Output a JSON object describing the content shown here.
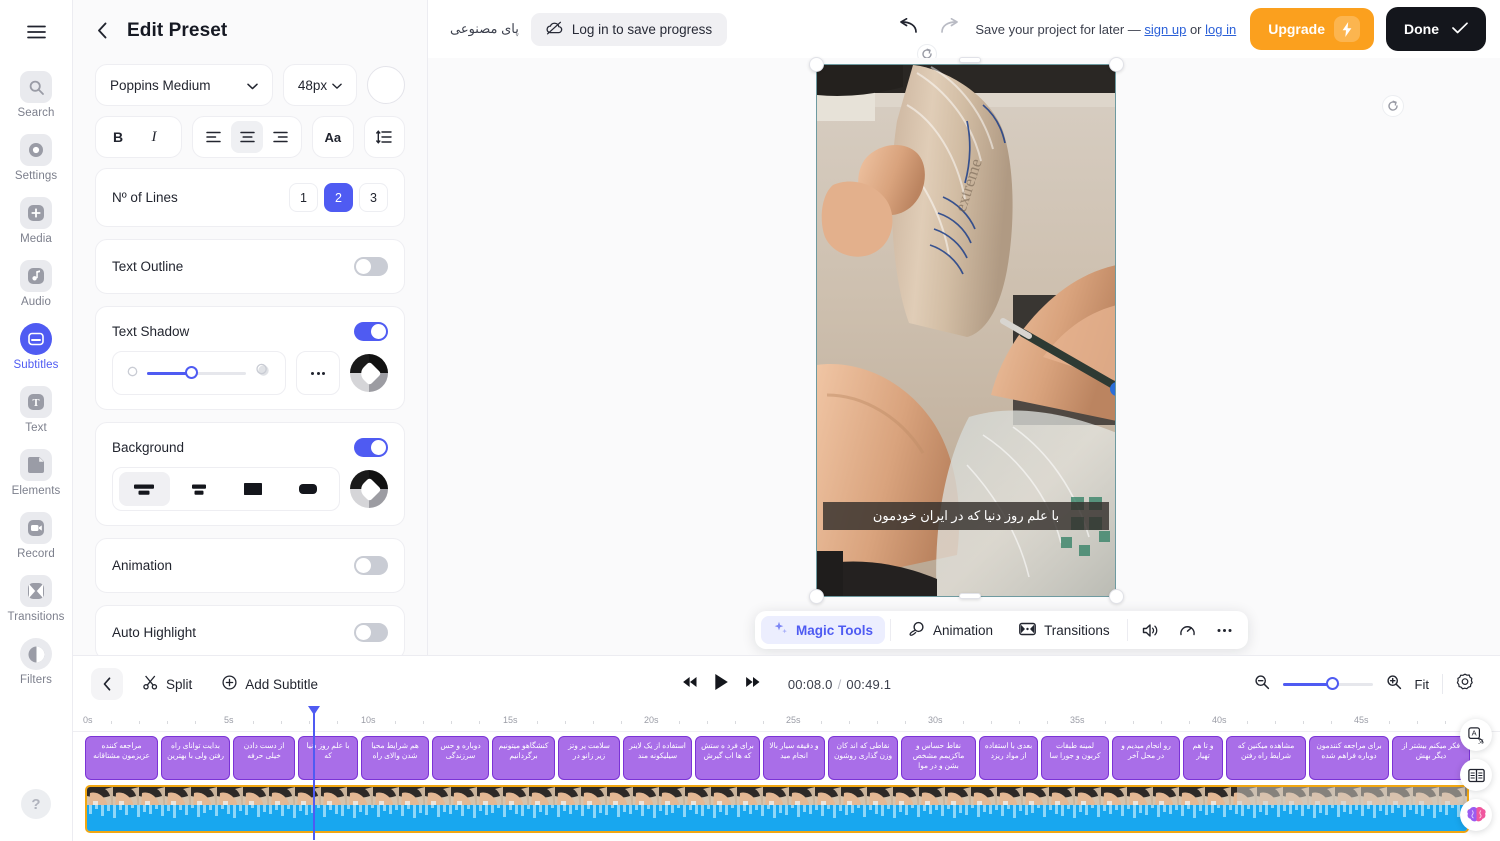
{
  "rail": {
    "menu_icon": "hamburger-icon",
    "items": [
      {
        "label": "Search",
        "icon": "search-icon",
        "active": false
      },
      {
        "label": "Settings",
        "icon": "gear-icon",
        "active": false
      },
      {
        "label": "Media",
        "icon": "plus-square-icon",
        "active": false
      },
      {
        "label": "Audio",
        "icon": "music-note-icon",
        "active": false
      },
      {
        "label": "Subtitles",
        "icon": "subtitles-icon",
        "active": true
      },
      {
        "label": "Text",
        "icon": "text-t-icon",
        "active": false
      },
      {
        "label": "Elements",
        "icon": "sticker-icon",
        "active": false
      },
      {
        "label": "Record",
        "icon": "record-camera-icon",
        "active": false
      },
      {
        "label": "Transitions",
        "icon": "transitions-icon",
        "active": false
      },
      {
        "label": "Filters",
        "icon": "filters-contrast-icon",
        "active": false
      }
    ],
    "help_label": "?"
  },
  "panel": {
    "title": "Edit Preset",
    "back_icon": "chevron-left-icon",
    "font_family": "Poppins Medium",
    "font_size": "48px",
    "color_swatch": "#ffffff",
    "bold_label": "B",
    "italic_label": "I",
    "align_options": [
      "align-left",
      "align-center",
      "align-right"
    ],
    "align_selected": "align-center",
    "case_label": "Aa",
    "line_height_icon": "line-height-icon",
    "lines": {
      "label": "Nº of Lines",
      "options": [
        "1",
        "2",
        "3"
      ],
      "selected": "2"
    },
    "text_outline": {
      "label": "Text Outline",
      "on": false
    },
    "text_shadow": {
      "label": "Text Shadow",
      "on": true,
      "more_icon": "more-dots-icon",
      "color_icon": "paint-bucket-icon"
    },
    "background": {
      "label": "Background",
      "on": true,
      "styles": [
        "bg-two-lines-wide",
        "bg-two-lines-narrow",
        "bg-solid-rect",
        "bg-rounded-rect"
      ],
      "selected": "bg-two-lines-wide",
      "color_icon": "paint-bucket-icon"
    },
    "animation": {
      "label": "Animation",
      "on": false
    },
    "auto_highlight": {
      "label": "Auto Highlight",
      "on": false
    }
  },
  "header": {
    "project_title": "پای مصنوعی",
    "login_pill": {
      "label": "Log in to save progress",
      "icon": "cloud-off-icon"
    },
    "undo_icon": "undo-arrow-icon",
    "redo_icon": "redo-arrow-icon",
    "reset_icon": "reset-circle-icon",
    "save_note_prefix": "Save your project for later — ",
    "save_note_signup": "sign up",
    "save_note_or": " or ",
    "save_note_login": "log in",
    "upgrade_label": "Upgrade",
    "upgrade_icon": "lightning-bolt-icon",
    "upgrade_color": "#fba01e",
    "done_label": "Done",
    "done_icon": "check-icon"
  },
  "canvas": {
    "rotate_icon": "rotate-handle-icon",
    "subtitle_text": "با علم روز دنیا که در ایران خودمون",
    "floating_toolbar": {
      "magic_tools": {
        "label": "Magic Tools",
        "icon": "sparkles-icon"
      },
      "animation": {
        "label": "Animation",
        "icon": "animation-orbit-icon"
      },
      "transitions": {
        "label": "Transitions",
        "icon": "transitions-icon"
      },
      "volume_icon": "speaker-icon",
      "speed_icon": "speedometer-icon",
      "more_icon": "more-dots-icon"
    }
  },
  "timeline": {
    "back_icon": "chevron-left-icon",
    "split": {
      "label": "Split",
      "icon": "scissors-icon"
    },
    "add_subtitle": {
      "label": "Add Subtitle",
      "icon": "plus-circle-icon"
    },
    "skip_back_icon": "skip-back-icon",
    "play_icon": "play-icon",
    "skip_forward_icon": "skip-forward-icon",
    "current_time": "00:08.0",
    "total_time": "00:49.1",
    "time_separator": "/",
    "zoom_out_icon": "zoom-out-icon",
    "zoom_in_icon": "zoom-in-icon",
    "fit_label": "Fit",
    "settings_icon": "gear-icon",
    "ruler_ticks": [
      "0s",
      "5s",
      "10s",
      "15s",
      "20s",
      "25s",
      "30s",
      "35s",
      "40s",
      "45s"
    ],
    "playhead_time": "00:08.0",
    "subtitle_clips": [
      "مراجعه کننده عزیزمون مشتاقانه",
      "بدایت توانای راه رفتن ولی با بهترین",
      "از دست دادن خیلی حرفه",
      "با علم روز دنیا که",
      "هم شرایط محیا شدن والای راه",
      "دوباره و حس سرزندگی",
      "کنشگاهو میتونیم برگردانیم",
      "سلامت پر وتز زیر زانو در",
      "استفاده از یک لاینر سیلیکونه مند",
      "برای فرد ه ستش که ها اب گیرش",
      "و دقیقه سیار بالا انجام مید",
      "نقاطی که اند کان وزن گذاری روشون",
      "نقاط حساس و ماکزیمم مشخص بشن و در موا",
      "بعدی با استفاده از مواد ریزد",
      "لمینه طبقات کربون و جورا سا",
      "رو انجام میدیم و در محل آخر",
      "و تا هم تهیار",
      "مشاهده میکنین که شرایط راه رفتن",
      "برای مراجعه کنندمون دوباره فراهم شده",
      "فکر میکنم بیشتر از دیگر بهش"
    ],
    "right_float_icons": [
      "translate-icon",
      "dictionary-book-icon",
      "brain-ai-icon"
    ]
  }
}
